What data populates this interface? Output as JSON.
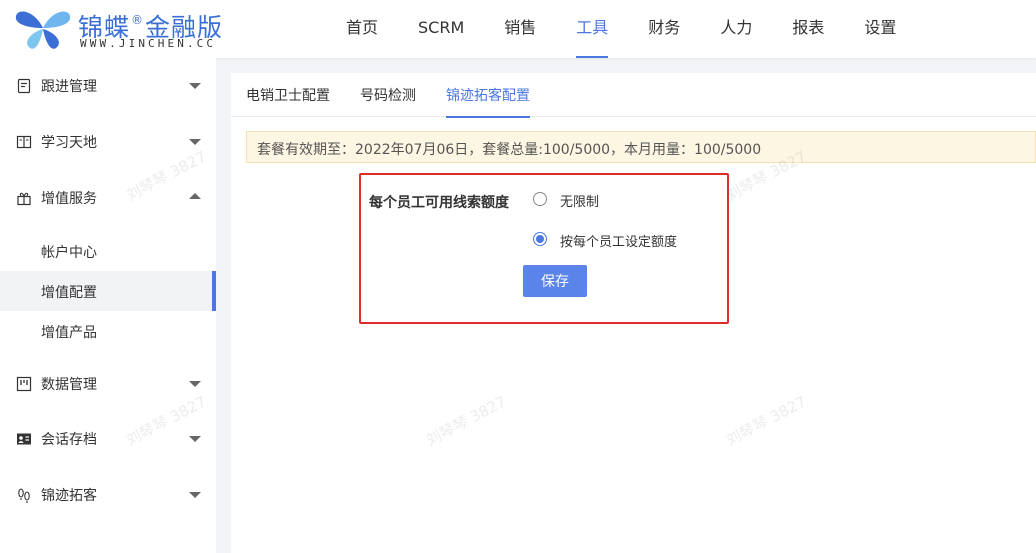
{
  "brand": {
    "name": "锦蝶",
    "registered_mark": "®",
    "edition": "金融版",
    "website": "WWW.JINCHEN.CC"
  },
  "nav": {
    "items": [
      {
        "label": "首页"
      },
      {
        "label": "SCRM"
      },
      {
        "label": "销售"
      },
      {
        "label": "工具",
        "active": true
      },
      {
        "label": "财务"
      },
      {
        "label": "人力"
      },
      {
        "label": "报表"
      },
      {
        "label": "设置"
      }
    ]
  },
  "sidebar": {
    "groups": [
      {
        "label": "跟进管理",
        "icon": "clipboard-icon",
        "expanded": false
      },
      {
        "label": "学习天地",
        "icon": "book-icon",
        "expanded": false
      },
      {
        "label": "增值服务",
        "icon": "gift-icon",
        "expanded": true
      },
      {
        "label": "数据管理",
        "icon": "board-icon",
        "expanded": false
      },
      {
        "label": "会话存档",
        "icon": "id-card-icon",
        "expanded": false
      },
      {
        "label": "锦迹拓客",
        "icon": "footprint-icon",
        "expanded": false
      }
    ],
    "sub_items": [
      {
        "label": "帐户中心"
      },
      {
        "label": "增值配置",
        "active": true
      },
      {
        "label": "增值产品"
      }
    ]
  },
  "tabs": [
    {
      "label": "电销卫士配置"
    },
    {
      "label": "号码检测"
    },
    {
      "label": "锦迹拓客配置",
      "active": true
    }
  ],
  "notice": {
    "text": "套餐有效期至：2022年07月06日，套餐总量:100/5000，本月用量：100/5000"
  },
  "form": {
    "label": "每个员工可用线索额度",
    "options": [
      {
        "label": "无限制",
        "checked": false
      },
      {
        "label": "按每个员工设定额度",
        "checked": true
      }
    ],
    "save_label": "保存"
  },
  "watermark": "刘琴琴 3827",
  "colors": {
    "accent": "#4a78e0",
    "button": "#5b84ea",
    "highlight_border": "#e02b2b",
    "notice_bg": "#fdf6e3"
  }
}
